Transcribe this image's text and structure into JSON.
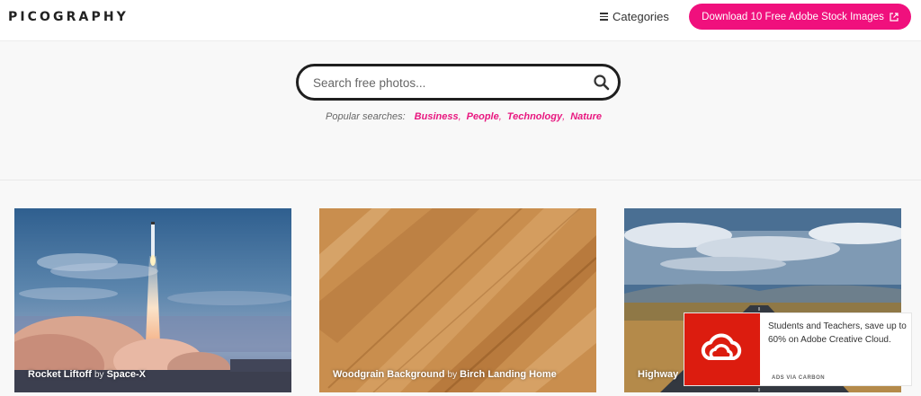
{
  "header": {
    "logo": "PICOGRAPHY",
    "categories_label": "Categories",
    "cta_label": "Download 10 Free Adobe Stock Images",
    "colors": {
      "accent": "#f0107d"
    }
  },
  "search": {
    "placeholder": "Search free photos...",
    "value": "",
    "popular_label": "Popular searches:",
    "popular": [
      "Business",
      "People",
      "Technology",
      "Nature"
    ]
  },
  "photos": [
    {
      "title": "Rocket Liftoff",
      "by": "by",
      "author": "Space-X"
    },
    {
      "title": "Woodgrain Background",
      "by": "by",
      "author": "Birch Landing Home"
    },
    {
      "title": "Highway",
      "by": "",
      "author": ""
    }
  ],
  "ad": {
    "text": "Students and Teachers, save up to 60% on Adobe Creative Cloud.",
    "via": "ADS VIA CARBON",
    "logo_color": "#dc1c0f"
  }
}
